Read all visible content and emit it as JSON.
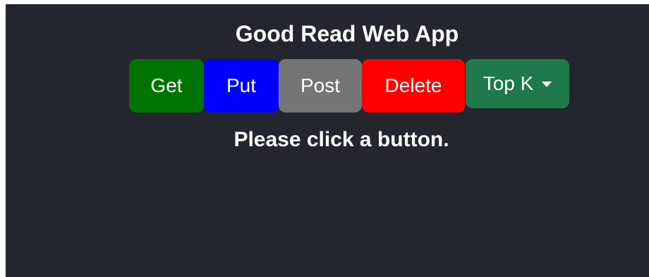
{
  "app": {
    "title": "Good Read Web App",
    "message": "Please click a button."
  },
  "buttons": [
    {
      "label": "Get",
      "color": "#007400"
    },
    {
      "label": "Put",
      "color": "#0000ff"
    },
    {
      "label": "Post",
      "color": "#757575"
    },
    {
      "label": "Delete",
      "color": "#ff0000"
    }
  ],
  "dropdown": {
    "label": "Top K",
    "color": "#1e7a4a",
    "icon": "caret-down-icon"
  }
}
